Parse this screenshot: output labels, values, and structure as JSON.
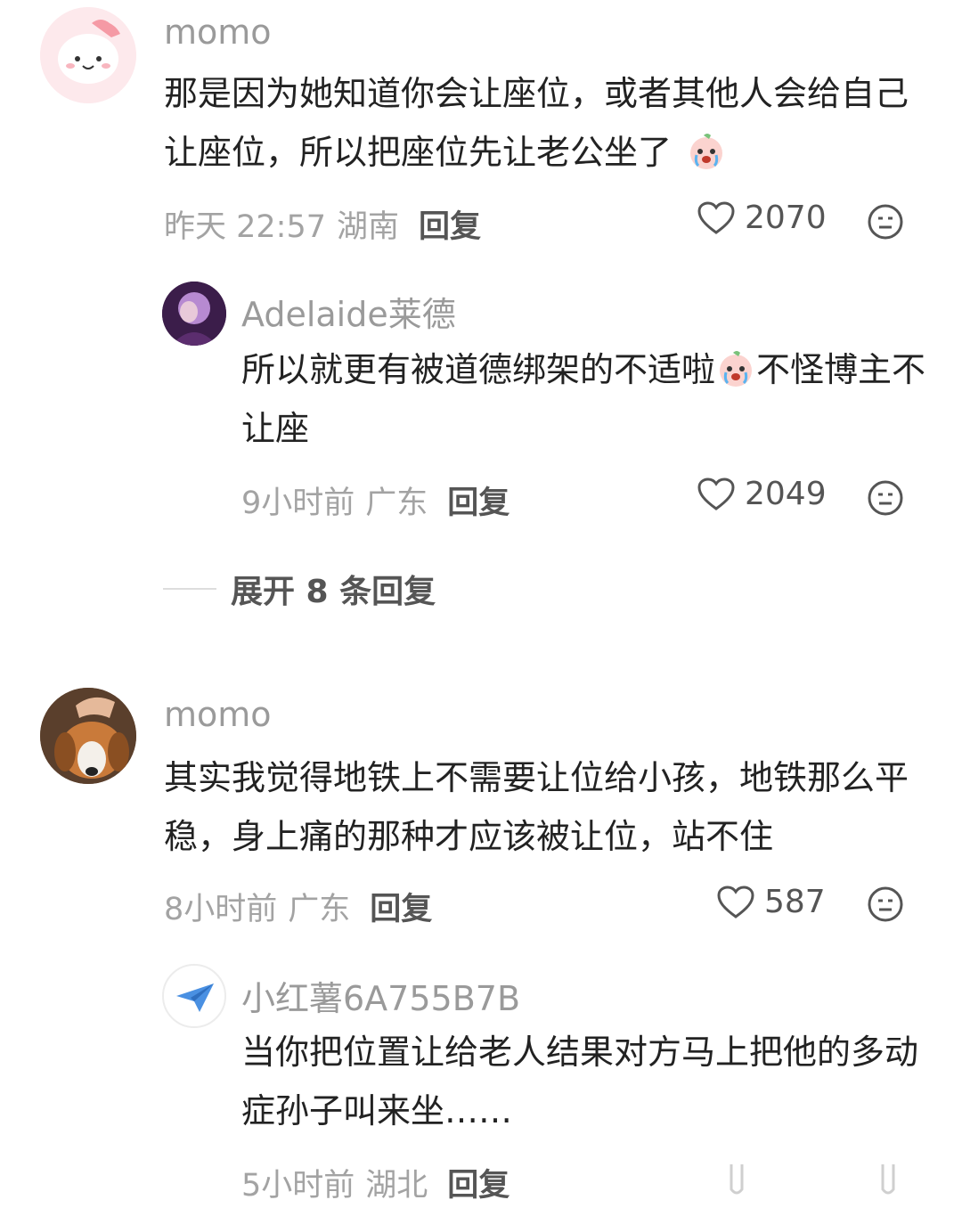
{
  "comments": [
    {
      "username": "momo",
      "text": "那是因为她知道你会让座位，或者其他人会给自己让座位，所以把座位先让老公坐了",
      "time": "昨天 22:57",
      "location": "湖南",
      "reply_label": "回复",
      "likes": "2070",
      "avatar_icon": "pink-character-avatar"
    },
    {
      "username": "Adelaide莱德",
      "text_before_emoji": "所以就更有被道德绑架的不适啦",
      "text_after_emoji": "不怪博主不让座",
      "time": "9小时前",
      "location": "广东",
      "reply_label": "回复",
      "likes": "2049",
      "avatar_icon": "purple-portrait-avatar"
    },
    {
      "username": "momo",
      "text": "其实我觉得地铁上不需要让位给小孩，地铁那么平稳，身上痛的那种才应该被让位，站不住",
      "time": "8小时前",
      "location": "广东",
      "reply_label": "回复",
      "likes": "587",
      "avatar_icon": "dog-photo-avatar"
    },
    {
      "username": "小红薯6A755B7B",
      "text": "当你把位置让给老人结果对方马上把他的多动症孙子叫来坐……",
      "time": "5小时前",
      "location": "湖北",
      "reply_label": "回复",
      "avatar_icon": "paper-plane-avatar"
    }
  ],
  "expand_replies": "展开 8 条回复",
  "colors": {
    "username": "#9a9a9a",
    "text": "#222222",
    "meta": "#a3a3a3",
    "reply": "#555555"
  }
}
